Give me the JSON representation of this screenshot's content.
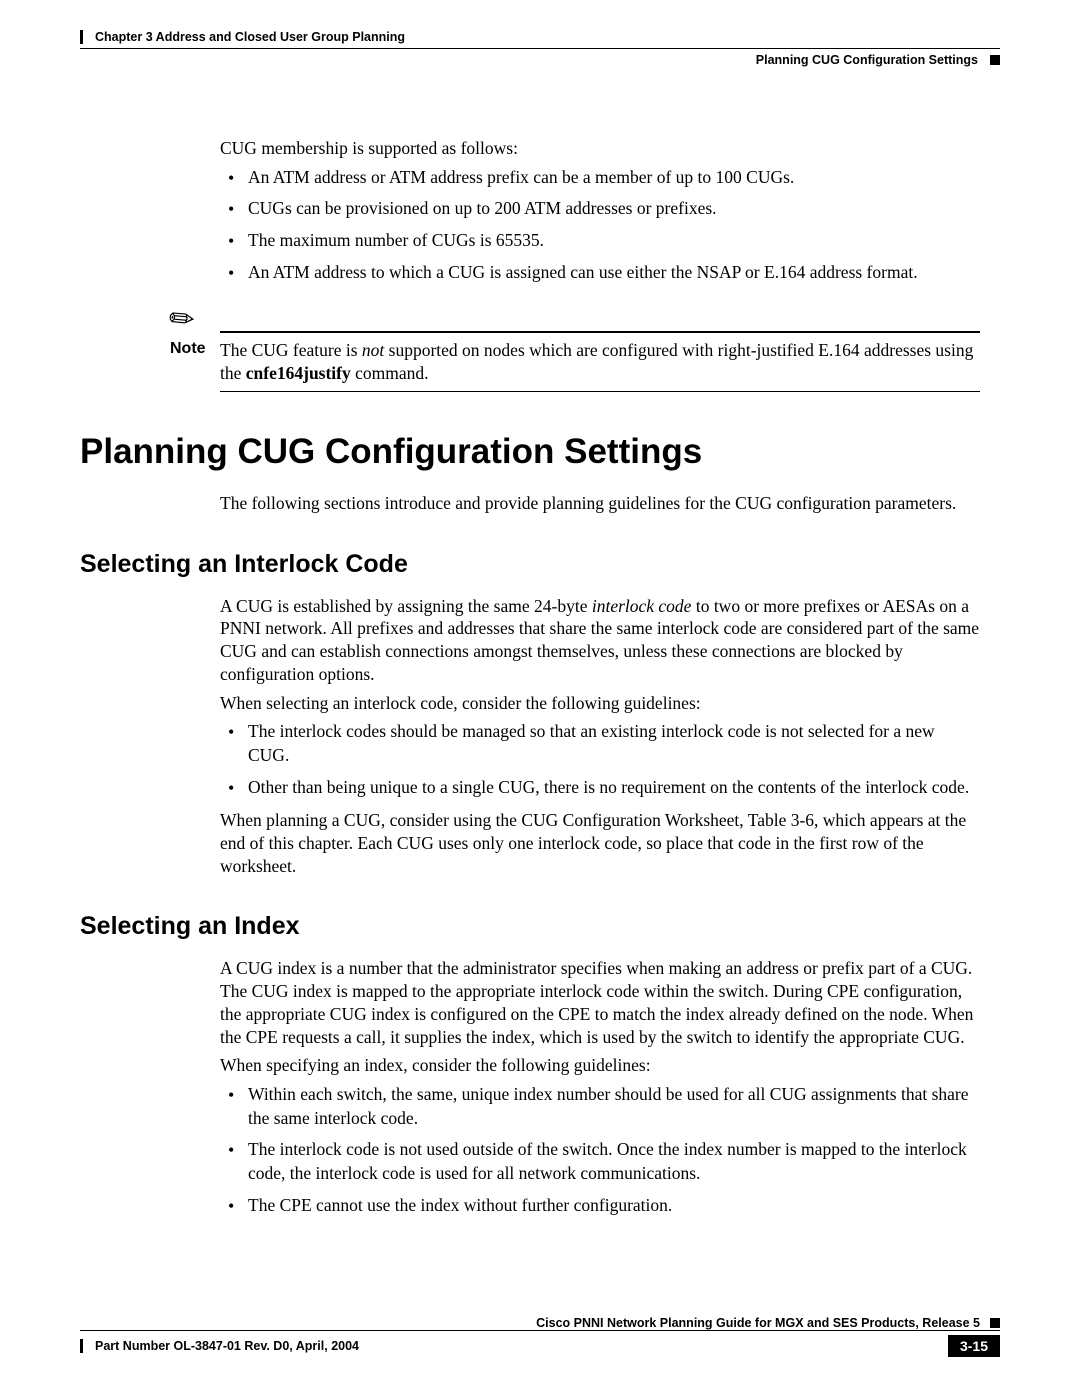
{
  "header": {
    "chapter": "Chapter 3    Address and Closed User Group Planning",
    "section": "Planning CUG Configuration Settings"
  },
  "intro": {
    "p1": "CUG membership is supported as follows:",
    "bullets": [
      "An ATM address or ATM address prefix can be a member of up to 100 CUGs.",
      "CUGs can be provisioned on up to 200 ATM addresses or prefixes.",
      "The maximum number of CUGs is 65535.",
      "An ATM address to which a CUG is assigned can use either the NSAP or E.164 address format."
    ]
  },
  "note": {
    "label": "Note",
    "t1": "The CUG feature is ",
    "not": "not",
    "t2": " supported on nodes which are configured with right-justified E.164 addresses using the ",
    "cmd": "cnfe164justify",
    "t3": " command."
  },
  "h1": "Planning CUG Configuration Settings",
  "h1_intro": "The following sections introduce and provide planning guidelines for the CUG configuration parameters.",
  "interlock": {
    "title": "Selecting an Interlock Code",
    "p1a": "A CUG is established by assigning the same 24-byte ",
    "p1_italic": "interlock code",
    "p1b": " to two or more prefixes or AESAs on a PNNI network. All prefixes and addresses that share the same interlock code are considered part of the same CUG and can establish connections amongst themselves, unless these connections are blocked by configuration options.",
    "p2": "When selecting an interlock code, consider the following guidelines:",
    "bullets": [
      "The interlock codes should be managed so that an existing interlock code is not selected for a new CUG.",
      "Other than being unique to a single CUG, there is no requirement on the contents of the interlock code."
    ],
    "p3": "When planning a CUG, consider using the CUG Configuration Worksheet, Table 3-6, which appears at the end of this chapter. Each CUG uses only one interlock code, so place that code in the first row of the worksheet."
  },
  "index": {
    "title": "Selecting an Index",
    "p1": "A CUG index is a number that the administrator specifies when making an address or prefix part of a CUG. The CUG index is mapped to the appropriate interlock code within the switch. During CPE configuration, the appropriate CUG index is configured on the CPE to match the index already defined on the node. When the CPE requests a call, it supplies the index, which is used by the switch to identify the appropriate CUG.",
    "p2": "When specifying an index, consider the following guidelines:",
    "bullets": [
      "Within each switch, the same, unique index number should be used for all CUG assignments that share the same interlock code.",
      "The interlock code is not used outside of the switch. Once the index number is mapped to the interlock code, the interlock code is used for all network communications.",
      "The CPE cannot use the index without further configuration."
    ]
  },
  "footer": {
    "title": "Cisco PNNI Network Planning Guide  for MGX and SES Products, Release 5",
    "part": "Part Number OL-3847-01 Rev. D0, April, 2004",
    "page": "3-15"
  }
}
